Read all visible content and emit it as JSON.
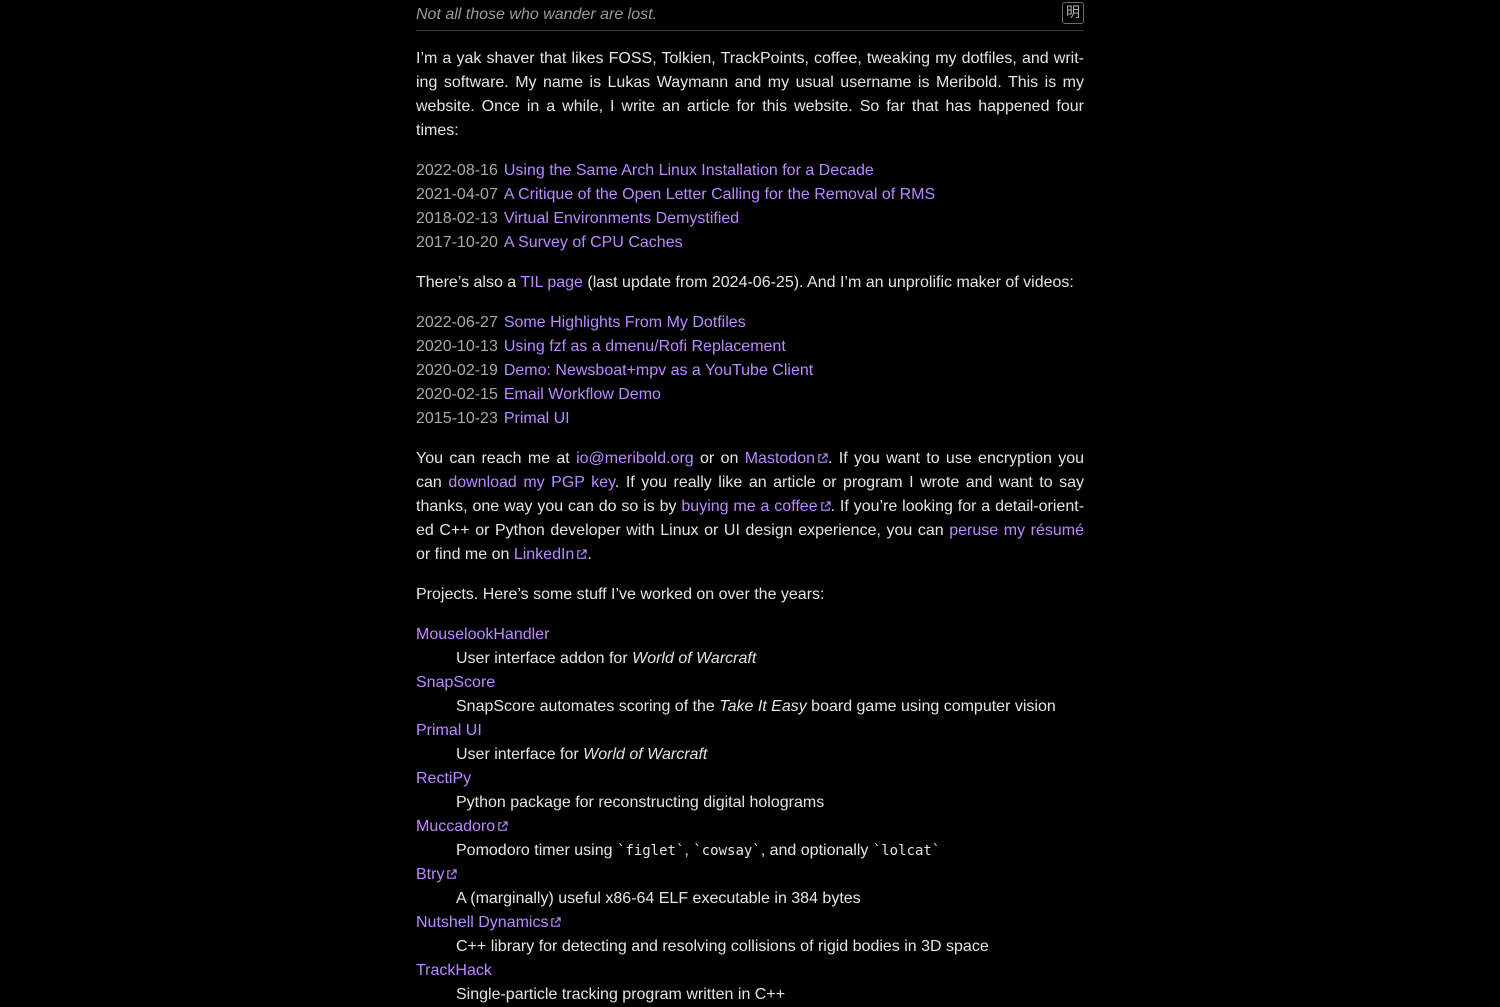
{
  "header": {
    "tagline": "Not all those who wander are lost.",
    "theme_toggle_label": "明"
  },
  "intro": {
    "text": "I’m a yak shaver that likes FOSS, Tolkien, TrackPoints, coffee, tweaking my dotfiles, and writ­ing software. My name is Lukas Waymann and my usual username is Meribold. This is my website. Once in a while, I write an article for this website. So far that has happened four times:"
  },
  "articles": [
    {
      "date": "2022-08-16",
      "title": "Using the Same Arch Linux Installation for a Decade"
    },
    {
      "date": "2021-04-07",
      "title": "A Critique of the Open Letter Calling for the Removal of RMS"
    },
    {
      "date": "2018-02-13",
      "title": "Virtual Environments Demystified"
    },
    {
      "date": "2017-10-20",
      "title": "A Survey of CPU Caches"
    }
  ],
  "til": {
    "before": "There’s also a ",
    "link": "TIL page",
    "after": " (last update from 2024-06-25). And I’m an unprolific maker of videos:"
  },
  "videos": [
    {
      "date": "2022-06-27",
      "title": "Some Highlights From My Dotfiles"
    },
    {
      "date": "2020-10-13",
      "title": "Using fzf as a dmenu/Rofi Replacement"
    },
    {
      "date": "2020-02-19",
      "title": "Demo: Newsboat+mpv as a YouTube Client"
    },
    {
      "date": "2020-02-15",
      "title": "Email Workflow Demo"
    },
    {
      "date": "2015-10-23",
      "title": "Primal UI"
    }
  ],
  "contact": {
    "t1": "You can reach me at ",
    "email": "io@meribold.org",
    "t2": " or on ",
    "mastodon": "Mastodon",
    "t3": ". If you want to use encryption you can ",
    "pgp": "download my PGP key",
    "t4": ". If you really like an article or program I wrote and want to say thanks, one way you can do so is by ",
    "coffee": "buying me a coffee",
    "t5": ". If you’re looking for a detail-orient­ed C++ or Python developer with Linux or UI design experience, you can ",
    "resume": "peruse my résumé",
    "t6": " or find me on ",
    "linkedin": "LinkedIn",
    "t7": "."
  },
  "projects_intro": "Projects. Here’s some stuff I’ve worked on over the years:",
  "projects": [
    {
      "name": "MouselookHandler",
      "desc_before": "User interface addon for ",
      "desc_em": "World of Warcraft",
      "desc_after": ""
    },
    {
      "name": "SnapScore",
      "desc_before": "SnapScore automates scoring of the ",
      "desc_em": "Take It Easy",
      "desc_after": " board game using computer vision"
    },
    {
      "name": "Primal UI",
      "desc_before": "User interface for ",
      "desc_em": "World of Warcraft",
      "desc_after": ""
    },
    {
      "name": "RectiPy",
      "desc_before": "Python package for reconstructing digital holograms",
      "desc_em": "",
      "desc_after": ""
    },
    {
      "name": "Muccadoro",
      "desc_before": "Pomodoro timer using ",
      "code1": "`figlet`",
      "mid1": ", ",
      "code2": "`cowsay`",
      "mid2": ", and optionally ",
      "code3": "`lolcat`"
    },
    {
      "name": "Btry",
      "desc_before": "A (marginally) useful x86-64 ELF executable in 384 bytes",
      "desc_em": "",
      "desc_after": ""
    },
    {
      "name": "Nutshell Dynamics",
      "desc_before": "C++ library for detecting and resolving collisions of rigid bodies in 3D space",
      "desc_em": "",
      "desc_after": ""
    },
    {
      "name": "TrackHack",
      "desc_before": "Single-particle tracking program written in C++",
      "desc_em": "",
      "desc_after": ""
    }
  ],
  "colors": {
    "background": "#000000",
    "text": "#e4e4e4",
    "link": "#bb88ff",
    "muted": "#a8a8a8"
  }
}
